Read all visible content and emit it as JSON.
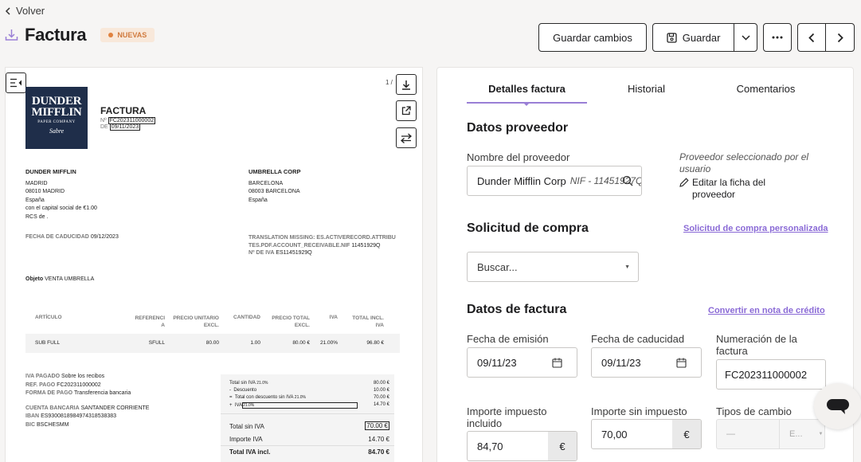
{
  "header": {
    "back_label": "Volver",
    "title": "Factura",
    "badge": "NUEVAS"
  },
  "toolbar": {
    "save_changes": "Guardar cambios",
    "save": "Guardar"
  },
  "doc": {
    "page_indicator": "1 /",
    "logo_line1": "DUNDER",
    "logo_line2": "MIFFLIN",
    "logo_small": "PAPER COMPANY",
    "logo_sabre": "Sabre",
    "logo_inc": "INC",
    "title": "FACTURA",
    "number_label": "Nº",
    "number_value": "FC202311000002",
    "date_label": "DE",
    "date_value": "09/11/2023",
    "seller": {
      "name": "DUNDER MIFFLIN",
      "line1": "MADRID",
      "line2": "08010   MADRID",
      "line3": "España",
      "line4": "con el capital social de €1.00",
      "line5": "RCS de ."
    },
    "buyer": {
      "name": "UMBRELLA CORP",
      "line1": "BARCELONA",
      "line2": "08003   BARCELONA",
      "line3": "España"
    },
    "due_label": "FECHA DE CADUCIDAD",
    "due_value": "09/12/2023",
    "missing_label": "TRANSLATION MISSING: ES.ACTIVERECORD.ATTRIBUTES.PDF.ACCOUNT_RECEIVABLE.NIF",
    "missing_value": "11451929Q",
    "vat_label": "Nº DE IVA",
    "vat_value": "ES11451929Q",
    "object_label": "Objeto",
    "object_value": "VENTA UMBRELLA",
    "table": {
      "headers": [
        "ARTÍCULO",
        "REFERENCIA",
        "PRECIO UNITARIO EXCL.",
        "CANTIDAD",
        "PRECIO TOTAL EXCL.",
        "IVA",
        "TOTAL INCL. IVA"
      ],
      "row": [
        "SUB FULL",
        "SFULL",
        "80.00",
        "1.00",
        "80.00 €",
        "21.00%",
        "96.80 €"
      ]
    },
    "pay": {
      "l1": "IVA PAGADO",
      "v1": "Sobre los recibos",
      "l2": "REF. PAGO",
      "v2": "FC202311000002",
      "l3": "FORMA DE PAGO",
      "v3": "Transferencia bancaria",
      "l4": "CUENTA BANCARIA",
      "v4": "SANTANDER CORRIENTE",
      "l5": "IBAN",
      "v5": "ES9300818984974318538383",
      "l6": "BIC",
      "v6": "BSCHESMM"
    },
    "totals": {
      "a": "Total sin IVA",
      "a_sup": "21.0%",
      "a_v": "80.00 €",
      "b": "Descuento",
      "b_v": "10.00 €",
      "c": "Total con descuento sin IVA",
      "c_sup": "21.0%",
      "c_v": "70.00 €",
      "d": "IVA",
      "d_sup": "21.0%",
      "d_v": "14.70 €",
      "t1": "Total sin IVA",
      "t1_v": "70.00 €",
      "t2": "Importe IVA",
      "t2_v": "14.70 €",
      "t3": "Total IVA incl.",
      "t3_v": "84.70 €"
    }
  },
  "tabs": [
    "Detalles factura",
    "Historial",
    "Comentarios"
  ],
  "supplier": {
    "heading": "Datos proveedor",
    "name_label": "Nombre del proveedor",
    "name_value": "Dunder Mifflin Corp",
    "nif": "NIF - 11451927Q",
    "selected_note": "Proveedor seleccionado por el usuario",
    "edit_link": "Editar la ficha del proveedor"
  },
  "purchase": {
    "heading": "Solicitud de compra",
    "custom_link": "Solicitud de compra personalizada",
    "search_placeholder": "Buscar..."
  },
  "invoice": {
    "heading": "Datos de factura",
    "credit_link": "Convertir en nota de crédito",
    "issue_label": "Fecha de emisión",
    "issue_value": "09/11/23",
    "due_label": "Fecha de caducidad",
    "due_value": "09/11/23",
    "number_label": "Numeración de la factura",
    "number_value": "FC202311000002",
    "tax_incl_label": "Importe impuesto incluido",
    "tax_incl_value": "84,70",
    "tax_excl_label": "Importe sin impuesto",
    "tax_excl_value": "70,00",
    "currency_symbol": "€",
    "fx_label": "Tipos de cambio",
    "fx_value": "—",
    "fx_currency": "E..."
  }
}
